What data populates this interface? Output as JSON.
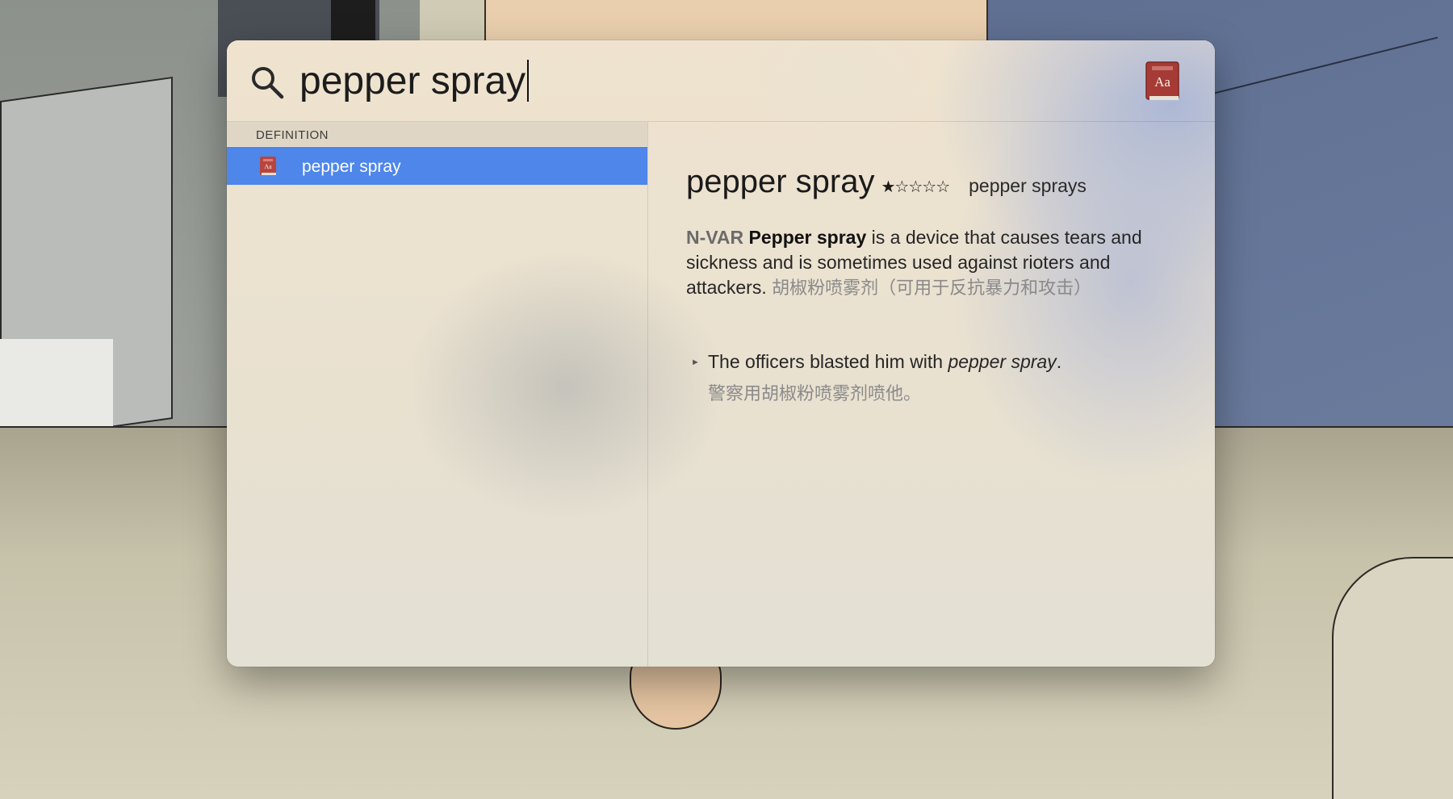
{
  "search": {
    "query": "pepper spray"
  },
  "results": {
    "section_header": "DEFINITION",
    "items": [
      {
        "label": "pepper spray",
        "selected": true
      }
    ]
  },
  "definition": {
    "headword": "pepper spray",
    "frequency_stars": "★☆☆☆☆",
    "plural": "pepper sprays",
    "pos": "N-VAR",
    "sense_headword": "Pepper spray",
    "sense_text": " is a device that causes tears and sickness and is sometimes used against rioters and attackers. ",
    "sense_translation": "胡椒粉喷雾剂（可用于反抗暴力和攻击）",
    "example_before": "The officers blasted him with ",
    "example_italic": "pepper spray",
    "example_after": ".",
    "example_translation": "警察用胡椒粉喷雾剂喷他。"
  },
  "colors": {
    "selection": "#4e86ea",
    "dictionary_icon": "#b8453f"
  },
  "icons": {
    "search": "search-icon",
    "dictionary": "dictionary-icon"
  }
}
